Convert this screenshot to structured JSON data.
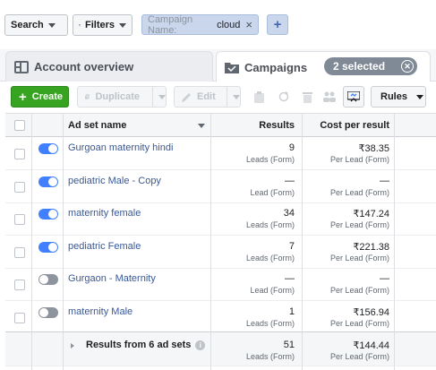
{
  "filterbar": {
    "search_label": "Search",
    "filters_label": "Filters",
    "chip_key": "Campaign Name:",
    "chip_value": "cloud",
    "chip_remove": "×",
    "add_label": "+"
  },
  "tabs": {
    "account_overview": "Account overview",
    "campaigns": "Campaigns",
    "selected": "2 selected",
    "clear": "✕"
  },
  "toolbar": {
    "create_label": "Create",
    "duplicate_label": "Duplicate",
    "edit_label": "Edit",
    "rules_label": "Rules"
  },
  "table": {
    "columns": {
      "name": "Ad set name",
      "results": "Results",
      "cost": "Cost per result"
    },
    "rows": [
      {
        "name": "Gurgoan maternity hindi",
        "on": true,
        "results": "9",
        "results_sub": "Leads (Form)",
        "cost": "₹38.35",
        "cost_sub": "Per Lead (Form)"
      },
      {
        "name": "pediatric Male - Copy",
        "on": true,
        "results": "—",
        "results_sub": "Lead (Form)",
        "cost": "—",
        "cost_sub": "Per Lead (Form)"
      },
      {
        "name": "maternity female",
        "on": true,
        "results": "34",
        "results_sub": "Leads (Form)",
        "cost": "₹147.24",
        "cost_sub": "Per Lead (Form)"
      },
      {
        "name": "pediatric Female",
        "on": true,
        "results": "7",
        "results_sub": "Leads (Form)",
        "cost": "₹221.38",
        "cost_sub": "Per Lead (Form)"
      },
      {
        "name": "Gurgaon - Maternity",
        "on": false,
        "results": "—",
        "results_sub": "Lead (Form)",
        "cost": "—",
        "cost_sub": "Per Lead (Form)"
      },
      {
        "name": "maternity Male",
        "on": false,
        "results": "1",
        "results_sub": "Leads (Form)",
        "cost": "₹156.94",
        "cost_sub": "Per Lead (Form)"
      }
    ],
    "summary": {
      "label": "Results from 6 ad sets",
      "info": "i",
      "results": "51",
      "results_sub": "Leads (Form)",
      "cost": "₹144.44",
      "cost_sub": "Per Lead (Form)"
    }
  }
}
